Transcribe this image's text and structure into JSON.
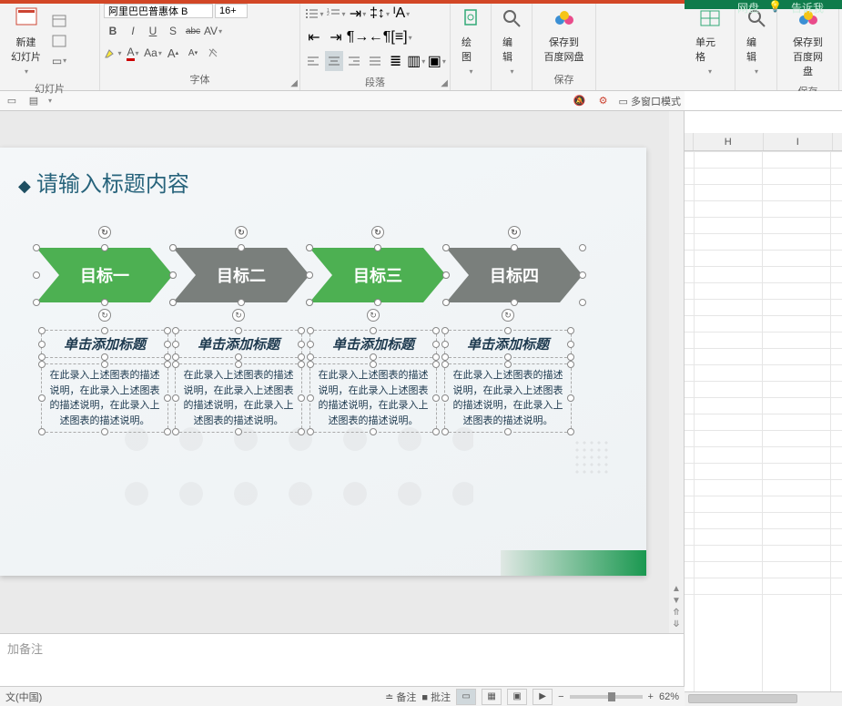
{
  "ribbon": {
    "slides": {
      "new_slide": "新建\n幻灯片",
      "label": "幻灯片"
    },
    "font": {
      "name_value": "阿里巴巴普惠体 B",
      "size_value": "16+",
      "bold": "B",
      "italic": "I",
      "underline": "U",
      "strike": "S",
      "strike2": "abc",
      "label": "字体"
    },
    "paragraph": {
      "label": "段落"
    },
    "draw": {
      "btn": "绘图",
      "label": ""
    },
    "edit": {
      "btn": "编辑",
      "label": ""
    },
    "save_baidu": {
      "btn": "保存到\n百度网盘",
      "label": "保存"
    }
  },
  "excel_ribbon": {
    "cells": {
      "btn": "单元格"
    },
    "edit": {
      "btn": "编辑"
    },
    "save": {
      "btn": "保存到\n百度网盘",
      "label": "保存"
    },
    "netdisk": "网盘",
    "tell_me": "告诉我"
  },
  "secbar": {
    "multiwin": "多窗口模式"
  },
  "slide": {
    "title": "请输入标题内容",
    "arrows": [
      "目标一",
      "目标二",
      "目标三",
      "目标四"
    ],
    "sub_title": "单击添加标题",
    "sub_body": "在此录入上述图表的描述说明，在此录入上述图表的描述说明，在此录入上述图表的描述说明。"
  },
  "notes": {
    "placeholder": "加备注"
  },
  "status": {
    "lang": "文(中国)",
    "notes_btn": "备注",
    "comments_btn": "批注",
    "zoom": "62%"
  },
  "excel": {
    "cols": [
      "H",
      "I"
    ]
  }
}
